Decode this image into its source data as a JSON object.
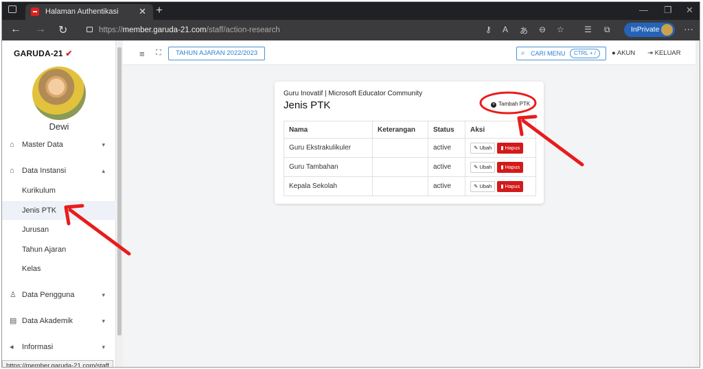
{
  "browser": {
    "tab_title": "Halaman Authentikasi",
    "url_prefix": "https://",
    "url_host": "member.garuda-21.com",
    "url_path": "/staff/action-research",
    "inprivate_label": "InPrivate"
  },
  "sidebar": {
    "logo": "GARUDA-21",
    "user_name": "Dewi",
    "items": [
      {
        "label": "Master Data",
        "icon": "home-icon",
        "chevron": "chevron-down-icon"
      },
      {
        "label": "Data Instansi",
        "icon": "building-icon",
        "chevron": "chevron-up-icon"
      },
      {
        "label": "Data Pengguna",
        "icon": "user-icon",
        "chevron": "chevron-down-icon"
      },
      {
        "label": "Data Akademik",
        "icon": "book-icon",
        "chevron": "chevron-down-icon"
      },
      {
        "label": "Informasi",
        "icon": "megaphone-icon",
        "chevron": "chevron-down-icon"
      }
    ],
    "sub_items": [
      "Kurikulum",
      "Jenis PTK",
      "Jurusan",
      "Tahun Ajaran",
      "Kelas"
    ],
    "active_sub": "Jenis PTK"
  },
  "status_url": "https://member.garuda-21.com/staff",
  "topbar": {
    "year_button": "TAHUN AJARAN 2022/2023",
    "search_button": "CARI MENU",
    "shortcut": "CTRL + /",
    "account": "AKUN",
    "logout": "KELUAR"
  },
  "card": {
    "subtitle": "Guru Inovatif | Microsoft Educator Community",
    "title": "Jenis PTK",
    "add_button": "Tambah PTK",
    "columns": [
      "Nama",
      "Keterangan",
      "Status",
      "Aksi"
    ],
    "rows": [
      {
        "nama": "Guru Ekstrakulikuler",
        "keterangan": "",
        "status": "active"
      },
      {
        "nama": "Guru Tambahan",
        "keterangan": "",
        "status": "active"
      },
      {
        "nama": "Kepala Sekolah",
        "keterangan": "",
        "status": "active"
      }
    ],
    "edit_label": "Ubah",
    "delete_label": "Hapus"
  },
  "colors": {
    "accent": "#2f7fd1",
    "danger": "#d31a1a",
    "annotation": "#e81c1c"
  }
}
